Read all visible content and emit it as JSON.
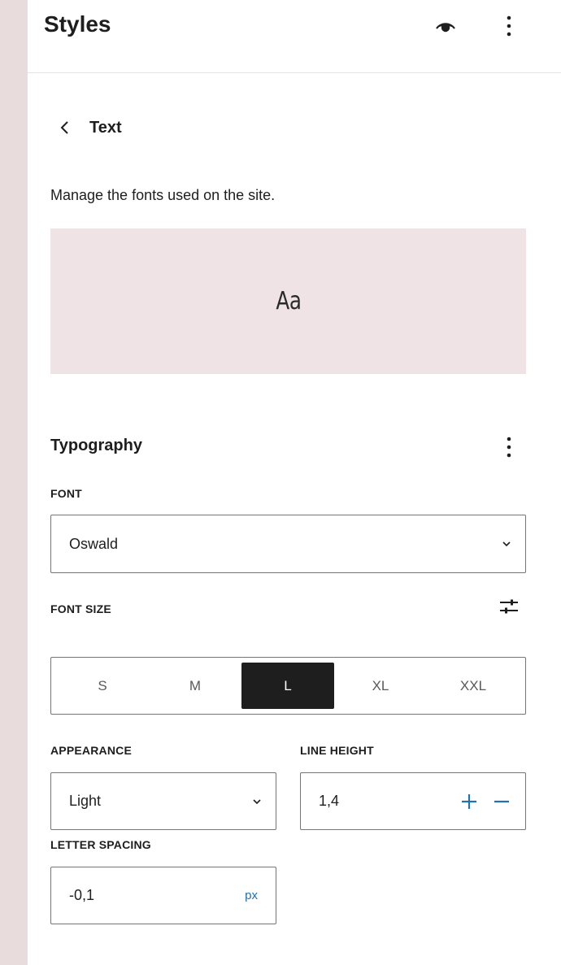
{
  "header": {
    "title": "Styles",
    "eye_icon": "eye-icon",
    "more_icon": "more-vertical-icon"
  },
  "nav": {
    "back_label": "Text",
    "back_icon": "chevron-left-icon"
  },
  "description": "Manage the fonts used on the site.",
  "preview": {
    "text": "Aa",
    "background": "#efe3e5"
  },
  "typography": {
    "title": "Typography",
    "font_label": "FONT",
    "font_value": "Oswald",
    "font_size_label": "FONT SIZE",
    "font_sizes": [
      {
        "label": "S",
        "active": false
      },
      {
        "label": "M",
        "active": false
      },
      {
        "label": "L",
        "active": true
      },
      {
        "label": "XL",
        "active": false
      },
      {
        "label": "XXL",
        "active": false
      }
    ],
    "appearance_label": "APPEARANCE",
    "appearance_value": "Light",
    "line_height_label": "LINE HEIGHT",
    "line_height_value": "1,4",
    "letter_spacing_label": "LETTER SPACING",
    "letter_spacing_value": "-0,1",
    "letter_spacing_unit": "px"
  },
  "colors": {
    "accent": "#2271b1",
    "active_bg": "#1e1e1e",
    "page_bg": "#e8dcdc"
  }
}
